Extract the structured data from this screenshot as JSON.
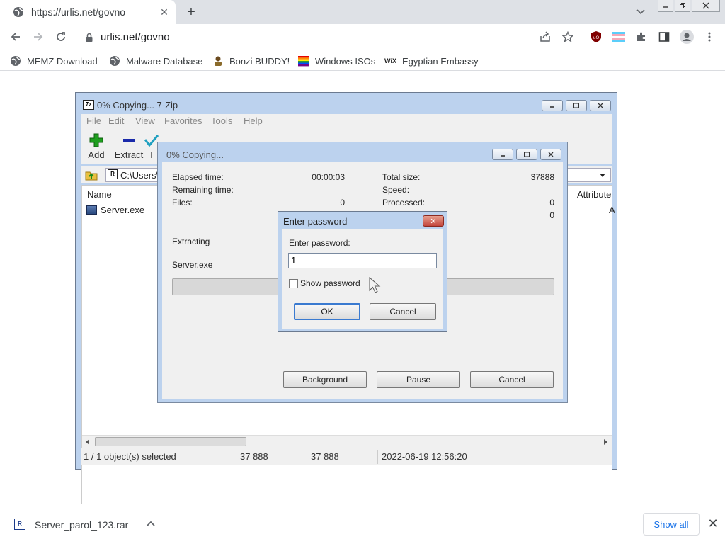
{
  "browser": {
    "tab_title": "https://urlis.net/govno",
    "tab_close": "✕",
    "newtab": "+",
    "url": "urlis.net/govno",
    "bookmarks": [
      {
        "label": "MEMZ Download",
        "icon": "globe-icon"
      },
      {
        "label": "Malware Database",
        "icon": "globe-icon"
      },
      {
        "label": "Bonzi BUDDY!",
        "icon": "bonzi-icon"
      },
      {
        "label": "Windows ISOs",
        "icon": "rainbow-flag-icon"
      },
      {
        "label": "Egyptian Embassy",
        "icon": "wix-icon"
      }
    ],
    "wix_mark": "WiX"
  },
  "zip_window": {
    "title": "0% Copying... 7-Zip",
    "logo": "7z",
    "menu": [
      "File",
      "Edit",
      "View",
      "Favorites",
      "Tools",
      "Help"
    ],
    "tools": [
      {
        "label": "Add",
        "color": "#1e9e1e"
      },
      {
        "label": "Extract",
        "color": "#1a2aaa"
      },
      {
        "label": "T",
        "color": "#20a0c0"
      }
    ],
    "path": "C:\\Users\\",
    "columns": {
      "name": "Name",
      "attributes": "Attribute"
    },
    "files": [
      {
        "name": "Server.exe",
        "attr": "A"
      }
    ],
    "status": {
      "selected": "1 / 1 object(s) selected",
      "size": "37 888",
      "packed": "37 888",
      "modified": "2022-06-19 12:56:20"
    }
  },
  "copy_dialog": {
    "title": "0% Copying...",
    "elapsed_label": "Elapsed time:",
    "elapsed_value": "00:00:03",
    "remaining_label": "Remaining time:",
    "files_label": "Files:",
    "files_value": "0",
    "total_label": "Total size:",
    "total_value": "37888",
    "speed_label": "Speed:",
    "processed_label": "Processed:",
    "processed_value": "0",
    "extra_value": "0",
    "action": "Extracting",
    "current_file": "Server.exe",
    "progress": 0,
    "buttons": {
      "background": "Background",
      "pause": "Pause",
      "cancel": "Cancel"
    }
  },
  "password_dialog": {
    "title": "Enter password",
    "close": "✕",
    "prompt": "Enter password:",
    "value": "1",
    "show_password": "Show password",
    "ok": "OK",
    "cancel": "Cancel"
  },
  "download_shelf": {
    "file_name": "Server_parol_123.rar",
    "show_all": "Show all",
    "close": "✕"
  }
}
